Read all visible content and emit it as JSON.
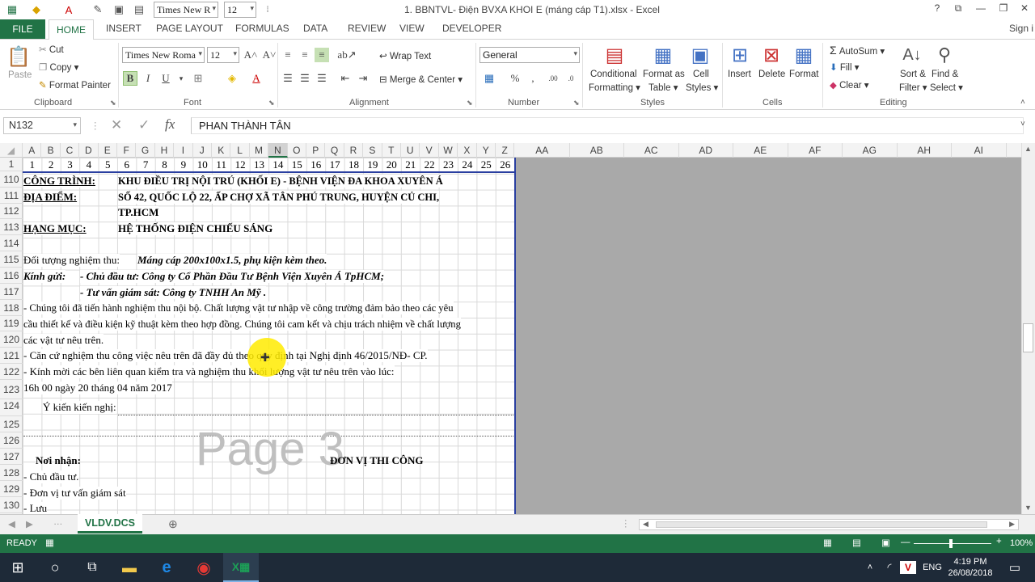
{
  "window": {
    "title": "1. BBNTVL- Điện BVXA KHOI E  (máng cáp T1).xlsx - Excel",
    "help": "?",
    "font_name": "Times New R",
    "font_size": "12",
    "signin": "Sign i"
  },
  "tabs": [
    "FILE",
    "HOME",
    "INSERT",
    "PAGE LAYOUT",
    "FORMULAS",
    "DATA",
    "REVIEW",
    "VIEW",
    "DEVELOPER"
  ],
  "ribbon": {
    "clipboard": {
      "paste": "Paste",
      "cut": "Cut",
      "copy": "Copy",
      "format_painter": "Format Painter",
      "label": "Clipboard"
    },
    "font": {
      "name": "Times New Roma",
      "size": "12",
      "label": "Font",
      "bold": "B",
      "italic": "I",
      "underline": "U"
    },
    "alignment": {
      "wrap": "Wrap Text",
      "merge": "Merge & Center",
      "label": "Alignment"
    },
    "number": {
      "format": "General",
      "percent": "%",
      "comma": ",",
      "label": "Number"
    },
    "styles": {
      "conditional1": "Conditional",
      "conditional2": "Formatting",
      "format_as1": "Format as",
      "format_as2": "Table",
      "cell1": "Cell",
      "cell2": "Styles",
      "label": "Styles"
    },
    "cells": {
      "insert": "Insert",
      "delete": "Delete",
      "format": "Format",
      "label": "Cells"
    },
    "editing": {
      "autosum": "AutoSum",
      "fill": "Fill",
      "clear": "Clear",
      "sort1": "Sort &",
      "sort2": "Filter",
      "find1": "Find &",
      "find2": "Select",
      "label": "Editing"
    }
  },
  "formula_bar": {
    "name_box": "N132",
    "fx": "fx",
    "value": "PHAN THÀNH TÂN"
  },
  "columns": [
    "A",
    "B",
    "C",
    "D",
    "E",
    "F",
    "G",
    "H",
    "I",
    "J",
    "K",
    "L",
    "M",
    "N",
    "O",
    "P",
    "Q",
    "R",
    "S",
    "T",
    "U",
    "V",
    "W",
    "X",
    "Y",
    "Z"
  ],
  "columns_right": [
    "AA",
    "AB",
    "AC",
    "AD",
    "AE",
    "AF",
    "AG",
    "AH",
    "AI"
  ],
  "row1_numbers": [
    "1",
    "2",
    "3",
    "4",
    "5",
    "6",
    "7",
    "8",
    "9",
    "10",
    "11",
    "12",
    "13",
    "14",
    "15",
    "16",
    "17",
    "18",
    "19",
    "20",
    "21",
    "22",
    "23",
    "24",
    "25",
    "26"
  ],
  "rows": [
    "1",
    "110",
    "111",
    "112",
    "113",
    "114",
    "115",
    "116",
    "117",
    "118",
    "119",
    "120",
    "121",
    "122",
    "123",
    "124",
    "125",
    "126",
    "127",
    "128",
    "129",
    "130"
  ],
  "cells": {
    "r110a": "CÔNG TRÌNH:",
    "r110b": "KHU ĐIỀU TRỊ NỘI TRÚ (KHỐI E) - BỆNH VIỆN ĐA KHOA XUYÊN Á",
    "r111a": "ĐỊA ĐIỂM:",
    "r111b": "SỐ 42, QUỐC LỘ  22, ẤP CHỢ XÃ TÂN PHÚ TRUNG, HUYỆN CỦ CHI,",
    "r112b": "TP.HCM",
    "r113a": "HẠNG MỤC:",
    "r113b": "HỆ THỐNG ĐIỆN CHIẾU SÁNG",
    "r115a": "Đối tượng nghiệm thu:",
    "r115b": "Máng cáp 200x100x1.5, phụ kiện kèm theo.",
    "r116a": "Kính gửi:",
    "r116b": "- Chủ đầu tư: Công ty Cổ Phần Đầu Tư Bệnh Viện Xuyên Á TpHCM;",
    "r117b": "- Tư vấn giám sát: Công ty TNHH An Mỹ .",
    "r118": "- Chúng tôi đã tiến hành nghiệm thu nội bộ. Chất lượng vật tư nhập về công trường đảm bảo theo các yêu",
    "r119": "cầu thiết kế và điều kiện kỹ thuật kèm theo hợp đồng. Chúng tôi cam kết và chịu trách nhiệm về chất lượng",
    "r120": "các vật tư nêu trên.",
    "r121": "- Căn cứ nghiệm thu công việc nêu trên đã đầy đủ theo quy định tại Nghị định 46/2015/NĐ- CP.",
    "r122": "- Kính mời các bên liên quan kiểm tra và nghiệm thu khối lượng vật tư nêu trên vào lúc:",
    "r123": "16h 00 ngày 20 tháng 04 năm 2017",
    "r124": "Ý kiến kiến nghị:",
    "r127a": "Nơi nhận:",
    "r127b": "ĐƠN VỊ THI CÔNG",
    "r128": "-  Chủ đầu tư.",
    "r129": "-  Đơn vị tư vấn giám sát",
    "r130": "-  Lưu"
  },
  "page_watermark": "Page 3",
  "sheet_tab": "VLDV.DCS",
  "status": {
    "ready": "READY",
    "zoom": "100%"
  },
  "taskbar": {
    "time": "4:19 PM",
    "date": "26/08/2018",
    "lang": "ENG"
  }
}
